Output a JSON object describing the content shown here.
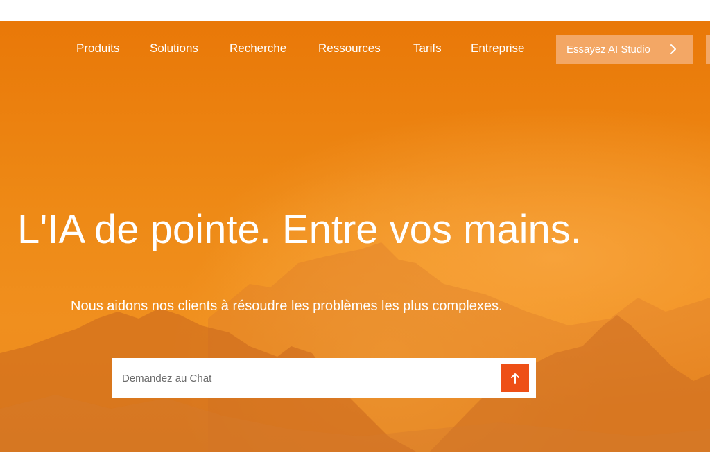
{
  "nav": {
    "items": [
      {
        "label": "Produits"
      },
      {
        "label": "Solutions"
      },
      {
        "label": "Recherche"
      },
      {
        "label": "Ressources"
      },
      {
        "label": "Tarifs"
      },
      {
        "label": "Entreprise"
      }
    ],
    "cta_label": "Essayez AI Studio",
    "cta_icon": "chevron-right-icon"
  },
  "hero": {
    "headline": "L'IA de pointe. Entre vos mains.",
    "subheadline": "Nous aidons nos clients à résoudre les problèmes les plus complexes."
  },
  "chat": {
    "placeholder": "Demandez au Chat",
    "send_icon": "arrow-up-icon"
  },
  "colors": {
    "hero_orange": "#ee8a16",
    "cta_background": "#f3a765",
    "send_button": "#ee4f16"
  }
}
